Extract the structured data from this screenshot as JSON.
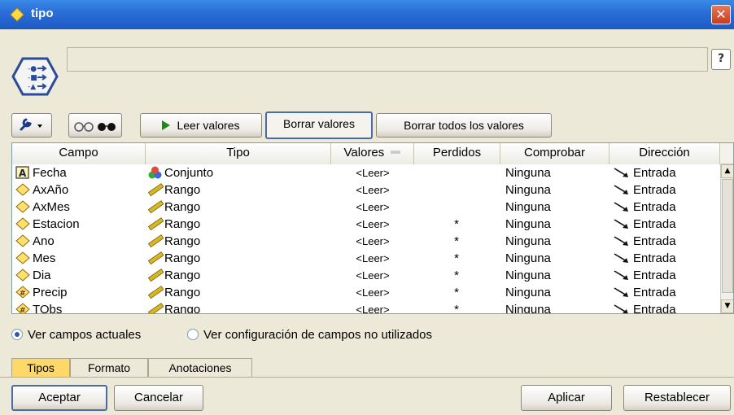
{
  "window": {
    "title": "tipo",
    "close_label": "✕"
  },
  "header": {
    "name_value": "",
    "help_label": "?"
  },
  "toolbar": {
    "leer_label": "Leer valores",
    "borrar_label": "Borrar valores",
    "borrar_todos_label": "Borrar todos los valores"
  },
  "table": {
    "columns": {
      "campo": "Campo",
      "tipo": "Tipo",
      "valores": "Valores",
      "perdidos": "Perdidos",
      "comprobar": "Comprobar",
      "direccion": "Dirección"
    },
    "rows": [
      {
        "campo": "Fecha",
        "campo_icon": "text-field-icon",
        "tipo": "Conjunto",
        "tipo_icon": "set-icon",
        "valores": "<Leer>",
        "perdidos": "",
        "comprobar": "Ninguna",
        "direccion": "Entrada"
      },
      {
        "campo": "AxAño",
        "campo_icon": "numeric-field-icon",
        "tipo": "Rango",
        "tipo_icon": "range-icon",
        "valores": "<Leer>",
        "perdidos": "",
        "comprobar": "Ninguna",
        "direccion": "Entrada"
      },
      {
        "campo": "AxMes",
        "campo_icon": "numeric-field-icon",
        "tipo": "Rango",
        "tipo_icon": "range-icon",
        "valores": "<Leer>",
        "perdidos": "",
        "comprobar": "Ninguna",
        "direccion": "Entrada"
      },
      {
        "campo": "Estacion",
        "campo_icon": "numeric-field-icon",
        "tipo": "Rango",
        "tipo_icon": "range-icon",
        "valores": "<Leer>",
        "perdidos": "*",
        "comprobar": "Ninguna",
        "direccion": "Entrada"
      },
      {
        "campo": "Ano",
        "campo_icon": "numeric-field-icon",
        "tipo": "Rango",
        "tipo_icon": "range-icon",
        "valores": "<Leer>",
        "perdidos": "*",
        "comprobar": "Ninguna",
        "direccion": "Entrada"
      },
      {
        "campo": "Mes",
        "campo_icon": "numeric-field-icon",
        "tipo": "Rango",
        "tipo_icon": "range-icon",
        "valores": "<Leer>",
        "perdidos": "*",
        "comprobar": "Ninguna",
        "direccion": "Entrada"
      },
      {
        "campo": "Dia",
        "campo_icon": "numeric-field-icon",
        "tipo": "Rango",
        "tipo_icon": "range-icon",
        "valores": "<Leer>",
        "perdidos": "*",
        "comprobar": "Ninguna",
        "direccion": "Entrada"
      },
      {
        "campo": "Precip",
        "campo_icon": "derived-field-icon",
        "tipo": "Rango",
        "tipo_icon": "range-icon",
        "valores": "<Leer>",
        "perdidos": "*",
        "comprobar": "Ninguna",
        "direccion": "Entrada"
      },
      {
        "campo": "TObs",
        "campo_icon": "derived-field-icon",
        "tipo": "Rango",
        "tipo_icon": "range-icon",
        "valores": "<Leer>",
        "perdidos": "*",
        "comprobar": "Ninguna",
        "direccion": "Entrada"
      }
    ]
  },
  "options": {
    "ver_actuales": "Ver campos actuales",
    "ver_no_utilizados": "Ver configuración de campos no utilizados"
  },
  "tabs": {
    "tipos": "Tipos",
    "formato": "Formato",
    "anotaciones": "Anotaciones"
  },
  "buttons": {
    "aceptar": "Aceptar",
    "cancelar": "Cancelar",
    "aplicar": "Aplicar",
    "restablecer": "Restablecer"
  },
  "colors": {
    "titlebar": "#2a6fd8",
    "active_tab": "#ffd86a",
    "range_icon": "#d8b820"
  }
}
